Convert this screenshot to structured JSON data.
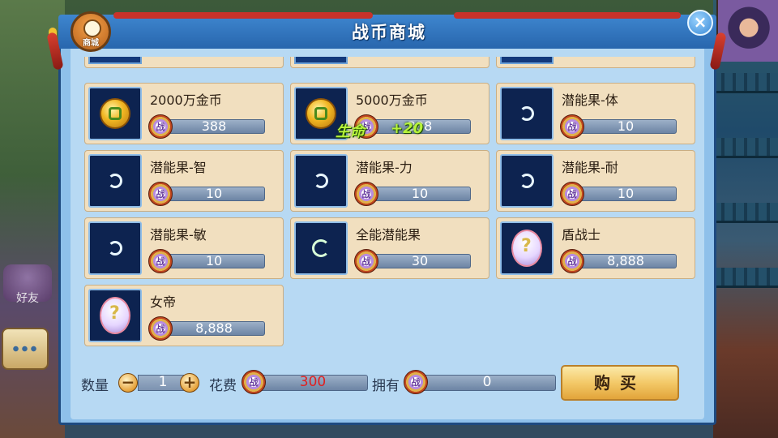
{
  "dialog": {
    "title": "战币商城",
    "shop_icon_label": "商城",
    "close_symbol": "×"
  },
  "background": {
    "left_labels": [
      "好友"
    ]
  },
  "items": [
    {
      "name": "2000万金币",
      "price": "388",
      "icon": "gold-coin-icon"
    },
    {
      "name": "5000万金币",
      "price": "388",
      "icon": "gold-coin-icon"
    },
    {
      "name": "潜能果-体",
      "price": "10",
      "icon": "potential-fruit-icon"
    },
    {
      "name": "潜能果-智",
      "price": "10",
      "icon": "potential-fruit-icon"
    },
    {
      "name": "潜能果-力",
      "price": "10",
      "icon": "potential-fruit-icon"
    },
    {
      "name": "潜能果-耐",
      "price": "10",
      "icon": "potential-fruit-icon"
    },
    {
      "name": "潜能果-敏",
      "price": "10",
      "icon": "potential-fruit-icon"
    },
    {
      "name": "全能潜能果",
      "price": "30",
      "icon": "all-potential-fruit-icon"
    },
    {
      "name": "盾战士",
      "price": "8,888",
      "icon": "mystery-egg-icon"
    },
    {
      "name": "女帝",
      "price": "8,888",
      "icon": "mystery-egg-icon"
    }
  ],
  "coin_glyph": "战",
  "float_effect": {
    "text": "生命",
    "value": "+20"
  },
  "purchase": {
    "quantity_label": "数量",
    "quantity": "1",
    "minus": "−",
    "plus": "+",
    "cost_label": "花费",
    "cost": "300",
    "owned_label": "拥有",
    "owned": "0",
    "buy_label": "购买"
  },
  "colors": {
    "cost_text": "#e02020",
    "accent": "#2866ad"
  }
}
